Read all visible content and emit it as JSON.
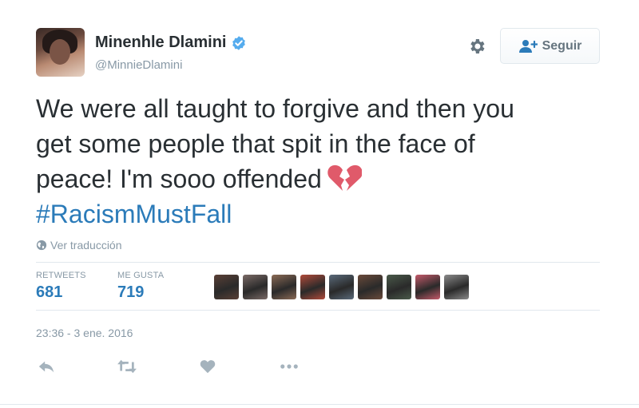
{
  "user": {
    "full_name": "Minenhle Dlamini",
    "screen_name": "@MinnieDlamini"
  },
  "follow_button": {
    "label": "Seguir"
  },
  "tweet": {
    "text_line1": "We were all taught to forgive and then you",
    "text_line2": "get some people that spit in the face of",
    "text_line3": "peace! I'm sooo offended",
    "hashtag": "#RacismMustFall",
    "translate_label": "Ver traducción",
    "timestamp": "23:36 - 3 ene. 2016"
  },
  "stats": {
    "retweets_label": "RETWEETS",
    "retweets_value": "681",
    "likes_label": "ME GUSTA",
    "likes_value": "719"
  },
  "liker_avatar_colors": [
    "#5a4036",
    "#7a6a66",
    "#8a6a55",
    "#b04a3a",
    "#5a6a7a",
    "#6a4a3a",
    "#4a5a4a",
    "#c45a6a",
    "#8a8a8a"
  ],
  "colors": {
    "accent": "#2b7bb9",
    "verified": "#55acee",
    "muted": "#8899a6",
    "heart_emoji": "#e05a6a"
  },
  "icons": {
    "verified": "verified-badge-icon",
    "gear": "gear-icon",
    "follow": "add-user-icon",
    "globe": "globe-icon",
    "reply": "reply-icon",
    "retweet": "retweet-icon",
    "like": "heart-icon",
    "more": "more-icon",
    "emoji": "broken-heart-emoji-icon"
  }
}
